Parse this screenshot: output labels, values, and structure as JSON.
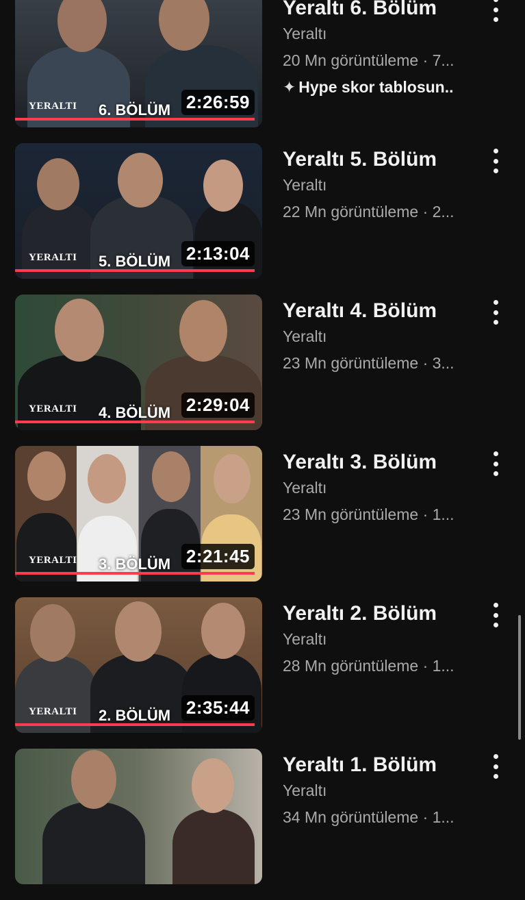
{
  "channel": "Yeraltı",
  "items": [
    {
      "title": "Yeraltı 6. Bölüm",
      "channel": "Yeraltı",
      "stats": "20 Mn görüntüleme · 7...",
      "extra": "Hype skor tablosun..",
      "duration": "2:26:59",
      "episode_label": "6. BÖLÜM",
      "brand": "YERALTI",
      "watched_fraction": 0.97
    },
    {
      "title": "Yeraltı 5. Bölüm",
      "channel": "Yeraltı",
      "stats": "22 Mn görüntüleme · 2...",
      "duration": "2:13:04",
      "episode_label": "5. BÖLÜM",
      "brand": "YERALTI",
      "watched_fraction": 0.97
    },
    {
      "title": "Yeraltı 4. Bölüm",
      "channel": "Yeraltı",
      "stats": "23 Mn görüntüleme · 3...",
      "duration": "2:29:04",
      "episode_label": "4. BÖLÜM",
      "brand": "YERALTI",
      "watched_fraction": 0.97
    },
    {
      "title": "Yeraltı 3. Bölüm",
      "channel": "Yeraltı",
      "stats": "23 Mn görüntüleme · 1...",
      "duration": "2:21:45",
      "episode_label": "3. BÖLÜM",
      "brand": "YERALTI",
      "watched_fraction": 0.97
    },
    {
      "title": "Yeraltı 2. Bölüm",
      "channel": "Yeraltı",
      "stats": "28 Mn görüntüleme · 1...",
      "duration": "2:35:44",
      "episode_label": "2. BÖLÜM",
      "brand": "YERALTI",
      "watched_fraction": 0.97
    },
    {
      "title": "Yeraltı 1. Bölüm",
      "channel": "Yeraltı",
      "stats": "34 Mn görüntüleme · 1...",
      "duration": "",
      "episode_label": "",
      "brand": "",
      "watched_fraction": 0
    }
  ],
  "icons": {
    "more": "more-vert-icon",
    "pin": "hype-icon"
  },
  "colors": {
    "background": "#0f0f0f",
    "progress": "#ff3b4f",
    "secondary_text": "#aaaaaa"
  }
}
